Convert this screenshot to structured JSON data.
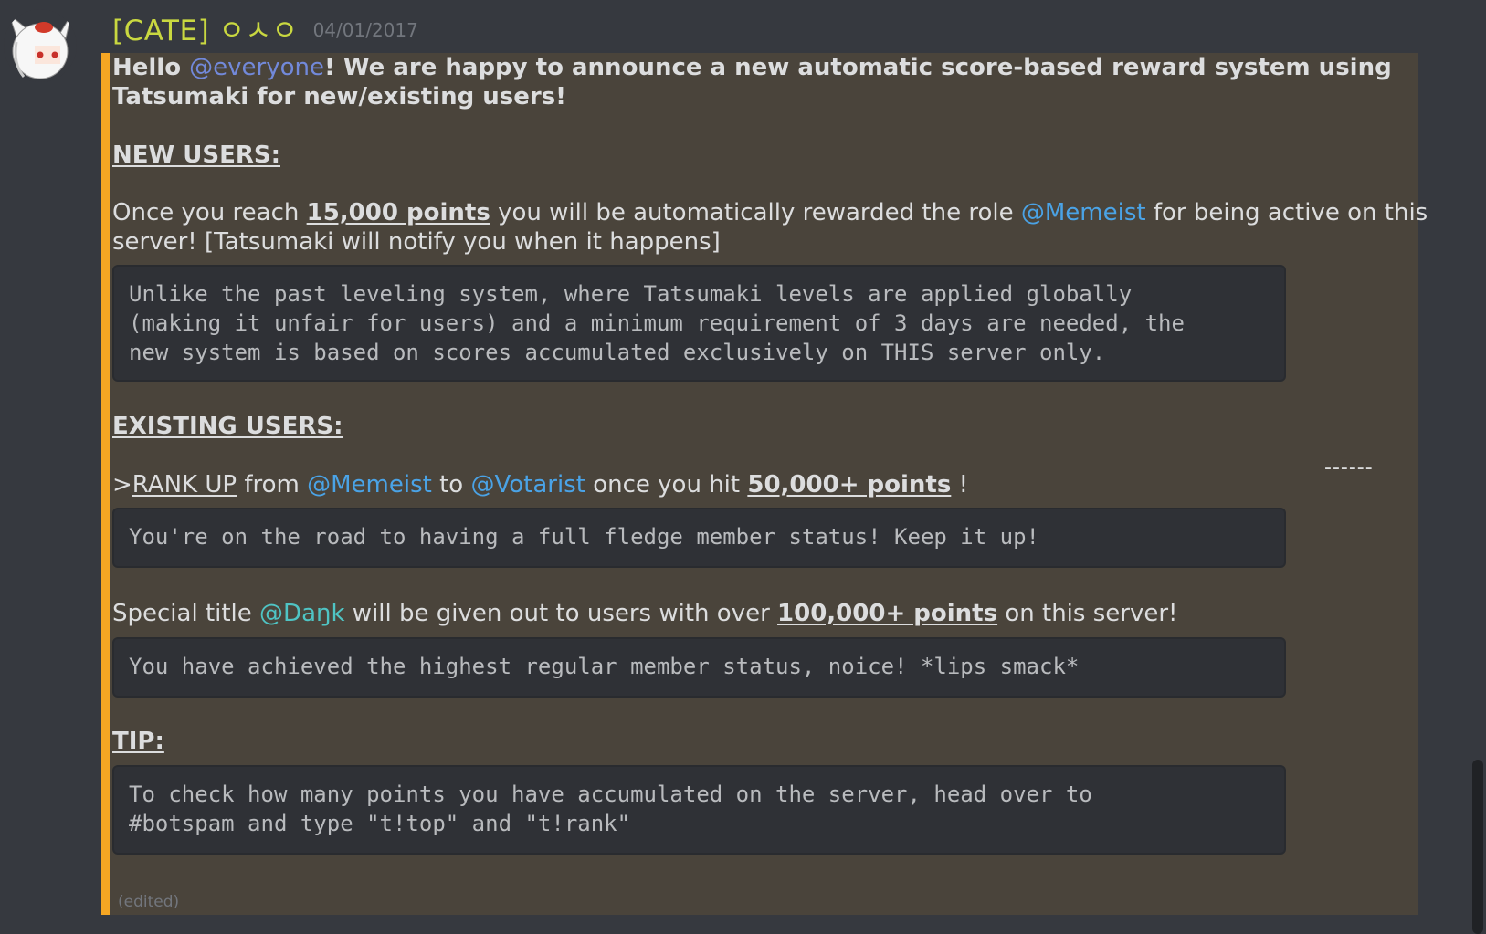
{
  "author": {
    "name": "[CATE] ㅇㅅㅇ",
    "timestamp": "04/01/2017"
  },
  "message": {
    "intro": {
      "hello": "Hello ",
      "mention": "@everyone",
      "rest": "! We are happy to announce a new automatic score-based reward system using",
      "line2": "Tatsumaki for new/existing users!"
    },
    "new_users": {
      "heading": "NEW USERS:",
      "line1_a": "Once you reach ",
      "line1_points": "15,000 points",
      "line1_b": " you will be automatically rewarded the role ",
      "line1_role": "@Memeist",
      "line1_c": " for being active on this",
      "line2": "server! [Tatsumaki will notify you when it happens]",
      "code": "Unlike the past leveling system, where Tatsumaki levels are applied globally\n(making it unfair for users) and a minimum requirement of 3 days are needed, the\nnew system is based on scores accumulated exclusively on THIS server only."
    },
    "existing_users": {
      "heading": "EXISTING USERS:",
      "rank_prefix": ">",
      "rank_up": "RANK UP",
      "from": " from ",
      "role_from": "@Memeist",
      "to": " to ",
      "role_to": "@Votarist",
      "hit": " once you hit ",
      "points": "50,000+ points",
      "end": " !",
      "code1": "You're on the road to having a full fledge member status! Keep it up!",
      "special_a": "Special title ",
      "special_role": "@Daŋk",
      "special_b": " will be given out to users with over ",
      "special_points": "100,000+ points",
      "special_c": " on this server!",
      "code2": "You have achieved the highest regular member status, noice! *lips smack*"
    },
    "tip": {
      "heading": "TIP:",
      "code": "To check how many points you have accumulated on the server, head over to\n#botspam and type \"t!top\" and \"t!rank\""
    },
    "edited": "(edited)",
    "dashes": "------"
  },
  "colors": {
    "accent": "#f5a623",
    "username": "#c9d840",
    "mention": "#7289da",
    "role_memeist": "#4aa3e6",
    "role_dank": "#4fc4c4"
  }
}
